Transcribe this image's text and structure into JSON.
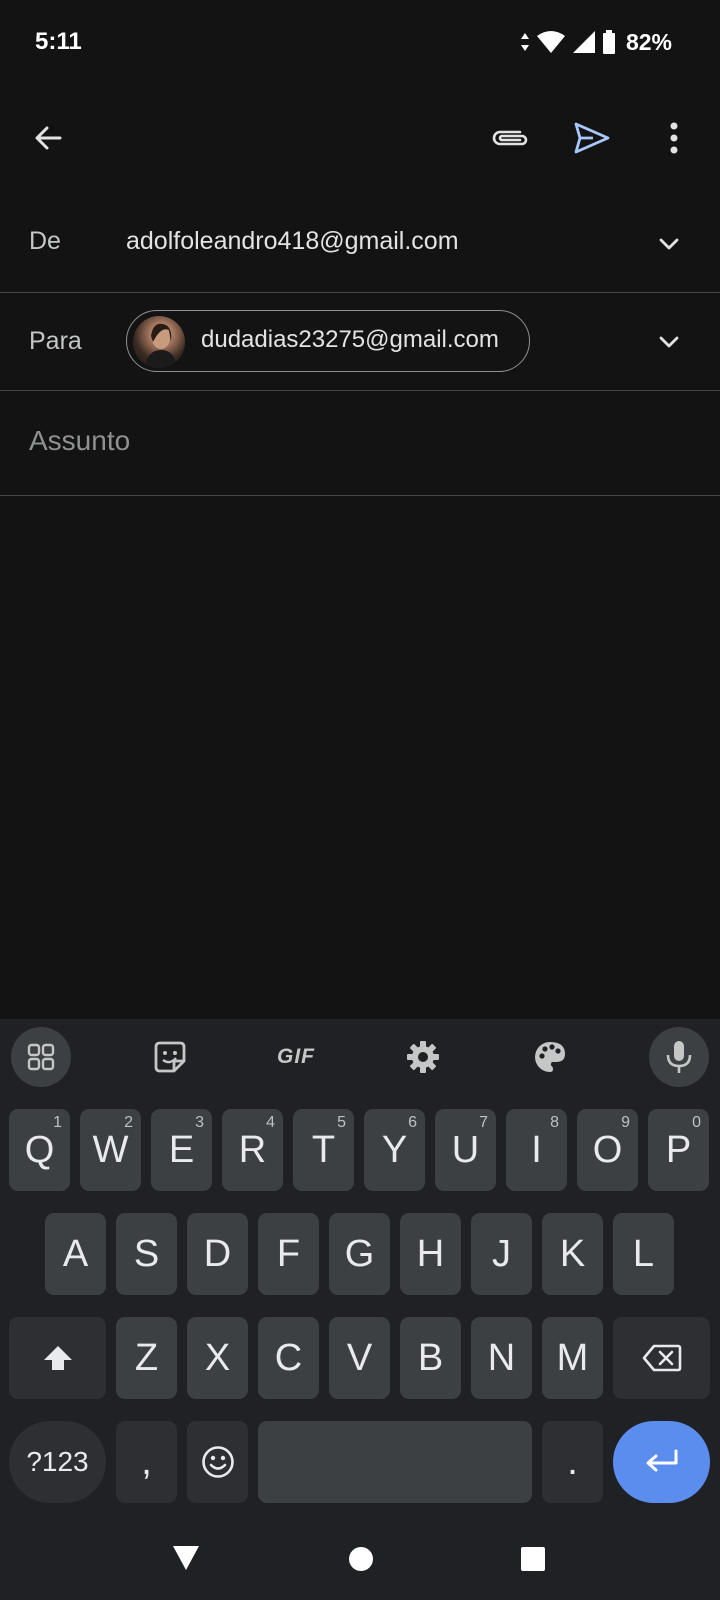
{
  "status": {
    "time": "5:11",
    "battery": "82%"
  },
  "appbar": {
    "back_icon": "arrow-left-icon",
    "attach_icon": "paperclip-icon",
    "send_icon": "send-icon",
    "more_icon": "more-vert-icon"
  },
  "from": {
    "label": "De",
    "value": "adolfoleandro418@gmail.com"
  },
  "to": {
    "label": "Para",
    "recipient": "dudadias23275@gmail.com"
  },
  "subject": {
    "placeholder": "Assunto"
  },
  "keyboard": {
    "toolbar": {
      "gif_label": "GIF"
    },
    "row1": [
      {
        "k": "Q",
        "h": "1"
      },
      {
        "k": "W",
        "h": "2"
      },
      {
        "k": "E",
        "h": "3"
      },
      {
        "k": "R",
        "h": "4"
      },
      {
        "k": "T",
        "h": "5"
      },
      {
        "k": "Y",
        "h": "6"
      },
      {
        "k": "U",
        "h": "7"
      },
      {
        "k": "I",
        "h": "8"
      },
      {
        "k": "O",
        "h": "9"
      },
      {
        "k": "P",
        "h": "0"
      }
    ],
    "row2": [
      "A",
      "S",
      "D",
      "F",
      "G",
      "H",
      "J",
      "K",
      "L"
    ],
    "row3": [
      "Z",
      "X",
      "C",
      "V",
      "B",
      "N",
      "M"
    ],
    "symbols_label": "?123",
    "comma": ",",
    "period": "."
  },
  "colors": {
    "accent": "#5b8def",
    "send": "#a8c7fa",
    "background": "#131314",
    "keyboard": "#1f2124"
  }
}
